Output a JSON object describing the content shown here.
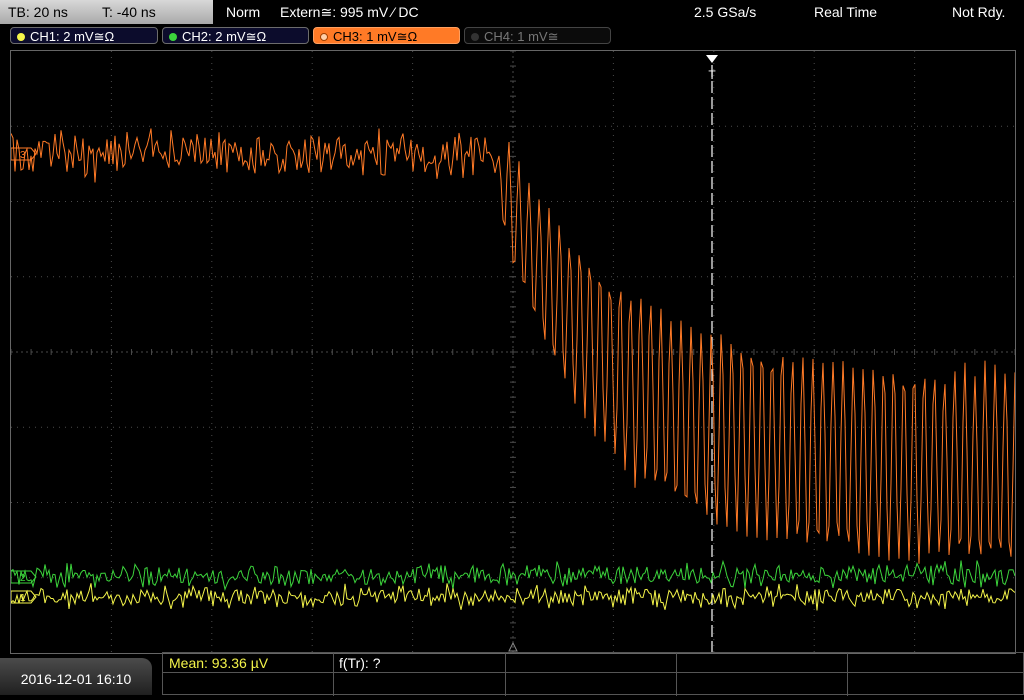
{
  "topbar": {
    "timebase": "TB: 20 ns",
    "trigger_time": "T: -40 ns",
    "trigger_mode": "Norm",
    "trigger_source": "Extern≅: 995 mV ⁄ DC",
    "sample_rate": "2.5 GSa/s",
    "acq_mode": "Real Time",
    "status": "Not Rdy."
  },
  "channels": [
    {
      "label": "CH1: 2 mV≅Ω",
      "color": "#f4f44a",
      "state": "on"
    },
    {
      "label": "CH2: 2 mV≅Ω",
      "color": "#3cd43c",
      "state": "on"
    },
    {
      "label": "CH3: 1 mV≅Ω",
      "color": "#ff7a26",
      "state": "active"
    },
    {
      "label": "CH4: 1 mV≅",
      "color": "#777777",
      "state": "off"
    }
  ],
  "markers": {
    "ch1": "1",
    "ch2": "2",
    "ch3": "3",
    "trigger": "T"
  },
  "bottom": {
    "datetime": "2016-12-01 16:10",
    "mean": "Mean: 93.36 µV",
    "ftr": "f(Tr): ?"
  },
  "colors": {
    "ch1": "#f4f44a",
    "ch2": "#3cd43c",
    "ch3": "#ff7a26",
    "grid": "#4a4a4a"
  }
}
